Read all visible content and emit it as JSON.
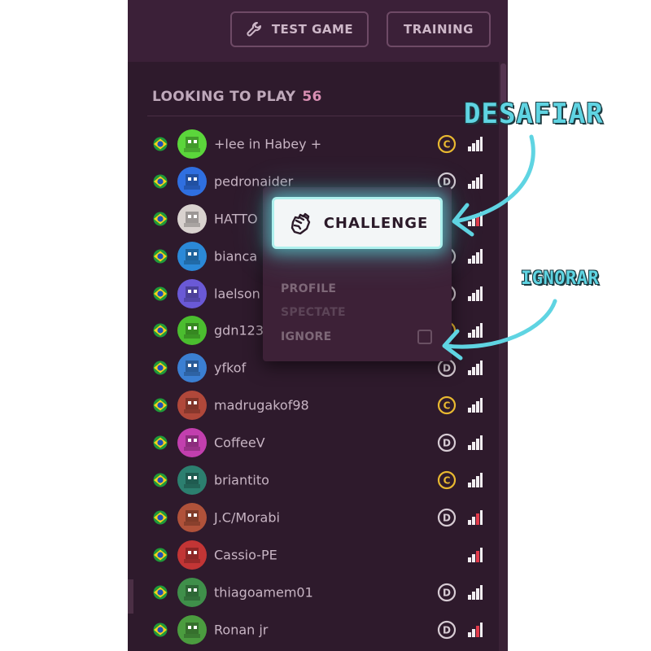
{
  "topbar": {
    "test_game_label": "TEST GAME",
    "training_label": "TRAINING"
  },
  "section": {
    "title": "LOOKING TO PLAY",
    "count": "56"
  },
  "players": [
    {
      "name": "+lee in Habey +",
      "badge": "C",
      "signal": "full",
      "avatar_color": "#5bd63b",
      "flag": "brazil"
    },
    {
      "name": "pedronaider",
      "badge": "D",
      "signal": "full",
      "avatar_color": "#2f6fe0",
      "flag": "brazil"
    },
    {
      "name": "HATTO",
      "badge": "",
      "signal": "weak",
      "avatar_color": "#d9d2cf",
      "flag": "brazil"
    },
    {
      "name": "bianca",
      "badge": "D",
      "signal": "full",
      "avatar_color": "#2b89d8",
      "flag": "brazil"
    },
    {
      "name": "laelson",
      "badge": "D",
      "signal": "full",
      "avatar_color": "#6a59d6",
      "flag": "brazil"
    },
    {
      "name": "gdn123",
      "badge": "C",
      "signal": "full",
      "avatar_color": "#4bbd2f",
      "flag": "brazil"
    },
    {
      "name": "yfkof",
      "badge": "D",
      "signal": "full",
      "avatar_color": "#3b7fd2",
      "flag": "brazil"
    },
    {
      "name": "madrugakof98",
      "badge": "C",
      "signal": "full",
      "avatar_color": "#b0483a",
      "flag": "brazil"
    },
    {
      "name": "CoffeeV",
      "badge": "D",
      "signal": "full",
      "avatar_color": "#c23fae",
      "flag": "brazil"
    },
    {
      "name": "briantito",
      "badge": "C",
      "signal": "full",
      "avatar_color": "#2c7f6f",
      "flag": "brazil"
    },
    {
      "name": "J.C/Morabi",
      "badge": "D",
      "signal": "weak",
      "avatar_color": "#b0523a",
      "flag": "brazil"
    },
    {
      "name": "Cassio-PE",
      "badge": "",
      "signal": "weak",
      "avatar_color": "#c23535",
      "flag": "brazil"
    },
    {
      "name": "thiagoamem01",
      "badge": "D",
      "signal": "full",
      "avatar_color": "#3f8f4a",
      "flag": "brazil"
    },
    {
      "name": "Ronan jr",
      "badge": "D",
      "signal": "weak",
      "avatar_color": "#4b9c3f",
      "flag": "brazil"
    }
  ],
  "popup": {
    "challenge_label": "CHALLENGE",
    "profile_label": "PROFILE",
    "spectate_label": "SPECTATE",
    "ignore_label": "IGNORE"
  },
  "annotations": {
    "challenge_note": "DESAFIAR",
    "ignore_note": "IGNORAR"
  },
  "colors": {
    "panel_bg": "#2e1a2c",
    "accent_cyan": "#5fd4e2",
    "badge_gold": "#e8b830",
    "badge_gray": "#d7ccd4",
    "signal_weak": "#e23b4b"
  }
}
